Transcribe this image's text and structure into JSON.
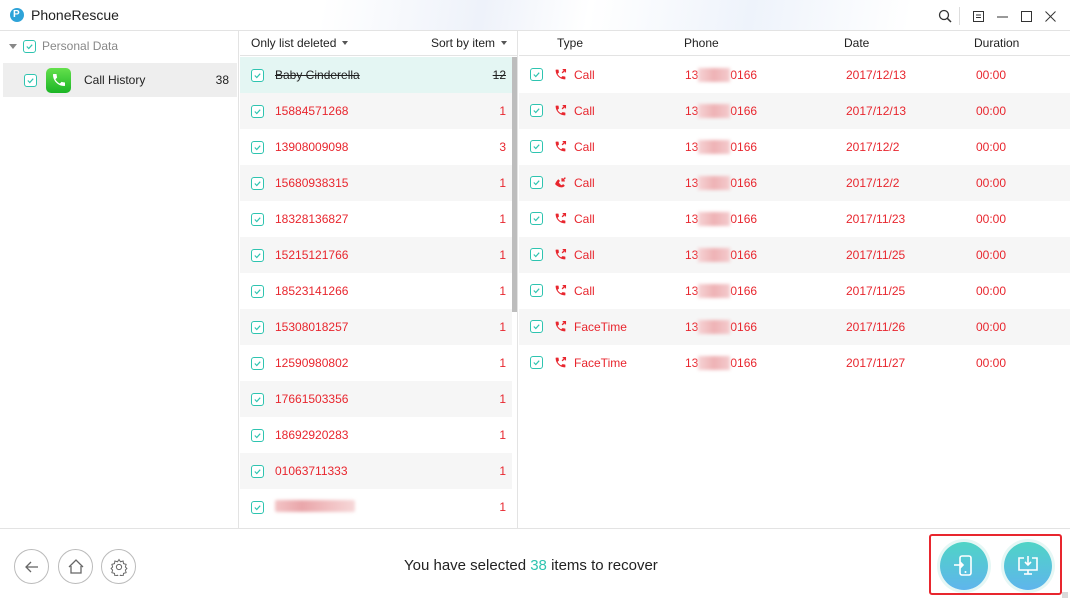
{
  "window": {
    "app_title": "PhoneRescue",
    "controls": [
      "search-icon",
      "menu-icon",
      "minimize-icon",
      "maximize-icon",
      "close-icon"
    ]
  },
  "sidebar": {
    "group_label": "Personal Data",
    "items": [
      {
        "label": "Call History",
        "count": "38",
        "icon": "phone-app-icon"
      }
    ]
  },
  "contacts": {
    "filter_label": "Only list deleted",
    "sort_label": "Sort by item",
    "rows": [
      {
        "name": "Baby Cinderella",
        "count": "12",
        "selected": true
      },
      {
        "name": "15884571268",
        "count": "1"
      },
      {
        "name": "13908009098",
        "count": "3"
      },
      {
        "name": "15680938315",
        "count": "1"
      },
      {
        "name": "18328136827",
        "count": "1"
      },
      {
        "name": "15215121766",
        "count": "1"
      },
      {
        "name": "18523141266",
        "count": "1"
      },
      {
        "name": "15308018257",
        "count": "1"
      },
      {
        "name": "12590980802",
        "count": "1"
      },
      {
        "name": "17661503356",
        "count": "1"
      },
      {
        "name": "18692920283",
        "count": "1"
      },
      {
        "name": "01063711333",
        "count": "1"
      },
      {
        "name": "",
        "count": "1",
        "blurred": true
      }
    ]
  },
  "details": {
    "headers": {
      "type": "Type",
      "phone": "Phone",
      "date": "Date",
      "duration": "Duration"
    },
    "rows": [
      {
        "type": "Call",
        "direction": "outgoing",
        "phone_prefix": "13",
        "phone_suffix": "0166",
        "date": "2017/12/13",
        "duration": "00:00"
      },
      {
        "type": "Call",
        "direction": "outgoing",
        "phone_prefix": "13",
        "phone_suffix": "0166",
        "date": "2017/12/13",
        "duration": "00:00"
      },
      {
        "type": "Call",
        "direction": "outgoing",
        "phone_prefix": "13",
        "phone_suffix": "0166",
        "date": "2017/12/2",
        "duration": "00:00"
      },
      {
        "type": "Call",
        "direction": "incoming",
        "phone_prefix": "13",
        "phone_suffix": "0166",
        "date": "2017/12/2",
        "duration": "00:00"
      },
      {
        "type": "Call",
        "direction": "outgoing",
        "phone_prefix": "13",
        "phone_suffix": "0166",
        "date": "2017/11/23",
        "duration": "00:00"
      },
      {
        "type": "Call",
        "direction": "outgoing",
        "phone_prefix": "13",
        "phone_suffix": "0166",
        "date": "2017/11/25",
        "duration": "00:00"
      },
      {
        "type": "Call",
        "direction": "outgoing",
        "phone_prefix": "13",
        "phone_suffix": "0166",
        "date": "2017/11/25",
        "duration": "00:00"
      },
      {
        "type": "FaceTime",
        "direction": "outgoing",
        "phone_prefix": "13",
        "phone_suffix": "0166",
        "date": "2017/11/26",
        "duration": "00:00"
      },
      {
        "type": "FaceTime",
        "direction": "outgoing",
        "phone_prefix": "13",
        "phone_suffix": "0166",
        "date": "2017/11/27",
        "duration": "00:00"
      }
    ]
  },
  "footer": {
    "status_prefix": "You have selected",
    "selected_count": "38",
    "status_suffix": "items to recover",
    "nav_buttons": [
      "back-icon",
      "home-icon",
      "settings-icon"
    ],
    "actions": [
      "recover-to-device",
      "recover-to-computer"
    ]
  },
  "colors": {
    "accent": "#2ec4b0",
    "deleted_text": "#e8262e",
    "selected_row": "#e4f6f3",
    "highlight_border": "#e8262e"
  }
}
